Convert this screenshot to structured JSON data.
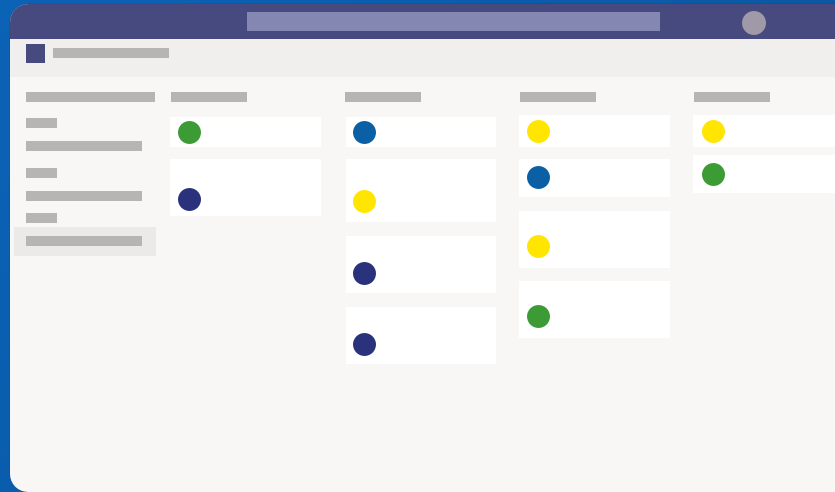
{
  "app": {
    "title": ""
  },
  "colors": {
    "desktop_bg": "#0b63b6",
    "topbar": "#464a7f",
    "search_bar": "#8487b2",
    "placeholder_gray": "#b6b5b3",
    "card_bg": "#ffffff",
    "status_green": "#3d9b35",
    "status_navy": "#29327a",
    "status_blue": "#0b5fa5",
    "status_yellow": "#ffe500"
  },
  "search": {
    "placeholder": ""
  },
  "sidebar": {
    "items": [
      {
        "label": ""
      },
      {
        "label": ""
      },
      {
        "label": ""
      },
      {
        "label": ""
      },
      {
        "label": ""
      },
      {
        "label": ""
      },
      {
        "label": ""
      },
      {
        "label": ""
      }
    ],
    "selected_index": 7
  },
  "board": {
    "columns": [
      {
        "title": "",
        "cards": [
          {
            "status_color": "green",
            "icon": "status-dot-icon"
          },
          {
            "status_color": "navy",
            "icon": "status-dot-icon"
          }
        ]
      },
      {
        "title": "",
        "cards": [
          {
            "status_color": "blue",
            "icon": "status-dot-icon"
          },
          {
            "status_color": "yellow",
            "icon": "status-dot-icon"
          },
          {
            "status_color": "navy",
            "icon": "status-dot-icon"
          },
          {
            "status_color": "navy",
            "icon": "status-dot-icon"
          }
        ]
      },
      {
        "title": "",
        "cards": [
          {
            "status_color": "yellow",
            "icon": "status-dot-icon"
          },
          {
            "status_color": "blue",
            "icon": "status-dot-icon"
          },
          {
            "status_color": "yellow",
            "icon": "status-dot-icon"
          },
          {
            "status_color": "green",
            "icon": "status-dot-icon"
          }
        ]
      },
      {
        "title": "",
        "cards": [
          {
            "status_color": "yellow",
            "icon": "status-dot-icon"
          },
          {
            "status_color": "green",
            "icon": "status-dot-icon"
          }
        ]
      }
    ]
  }
}
